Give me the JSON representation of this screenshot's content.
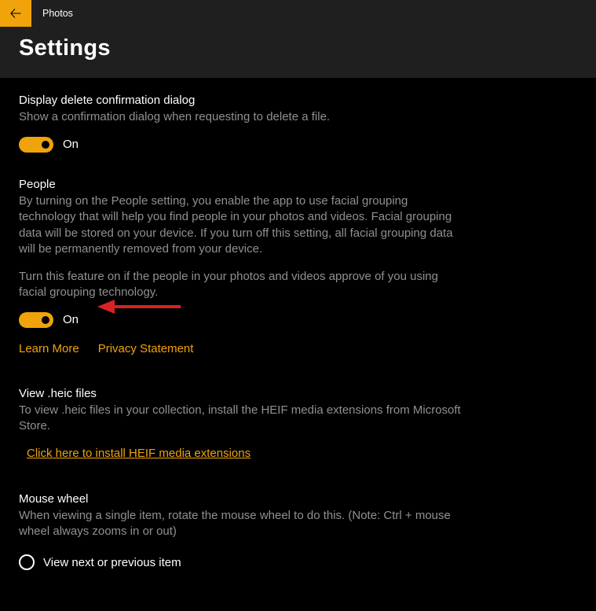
{
  "app": {
    "title": "Photos"
  },
  "page": {
    "title": "Settings"
  },
  "settings": {
    "delete_confirm": {
      "label": "Display delete confirmation dialog",
      "desc": "Show a confirmation dialog when requesting to delete a file.",
      "toggle_state": "On"
    },
    "people": {
      "label": "People",
      "desc1": "By turning on the People setting, you enable the app to use facial grouping technology that will help you find people in your photos and videos. Facial grouping data will be stored on your device. If you turn off this setting, all facial grouping data will be permanently removed from your device.",
      "desc2": "Turn this feature on if the people in your photos and videos approve of you using facial grouping technology.",
      "toggle_state": "On",
      "learn_more": "Learn More",
      "privacy": "Privacy Statement"
    },
    "heic": {
      "label": "View .heic files",
      "desc": "To view .heic files in your collection, install the HEIF media extensions from Microsoft Store.",
      "link": "Click here to install HEIF media extensions"
    },
    "mouse_wheel": {
      "label": "Mouse wheel",
      "desc": "When viewing a single item, rotate the mouse wheel to do this. (Note: Ctrl + mouse wheel always zooms in or out)",
      "option1": "View next or previous item"
    }
  },
  "colors": {
    "accent": "#f0a30a",
    "annotation": "#d82323"
  }
}
